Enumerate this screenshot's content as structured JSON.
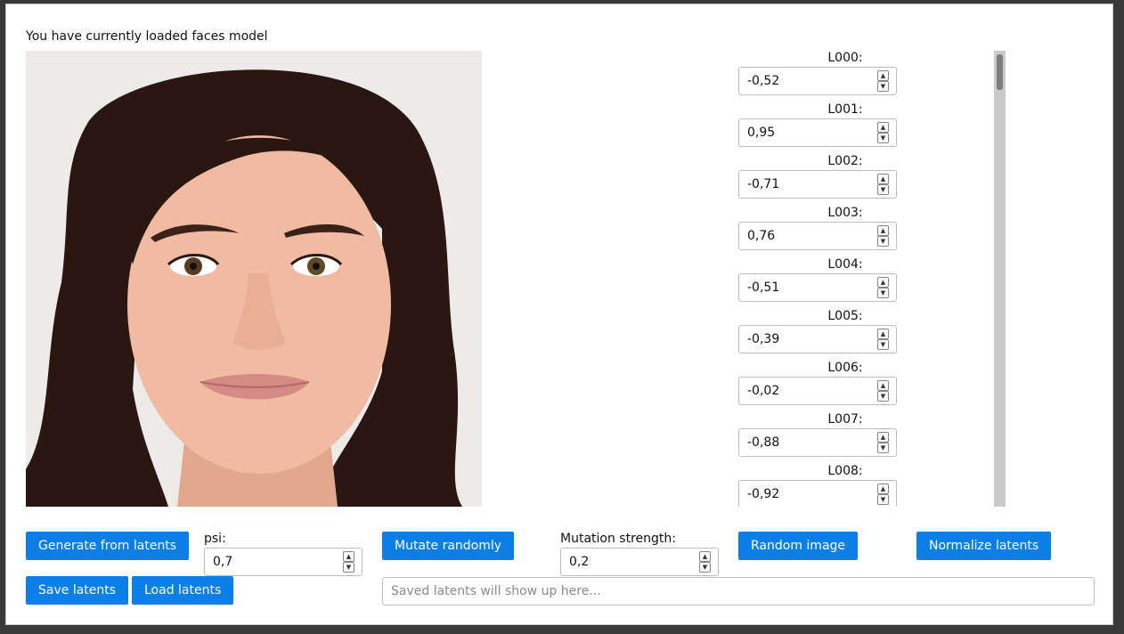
{
  "header": {
    "title": "You have currently loaded faces model"
  },
  "image": {
    "subject": "face-portrait",
    "background_color": "#ecebea"
  },
  "latents": [
    {
      "label": "L000:",
      "value": "-0,52"
    },
    {
      "label": "L001:",
      "value": "0,95"
    },
    {
      "label": "L002:",
      "value": "-0,71"
    },
    {
      "label": "L003:",
      "value": "0,76"
    },
    {
      "label": "L004:",
      "value": "-0,51"
    },
    {
      "label": "L005:",
      "value": "-0,39"
    },
    {
      "label": "L006:",
      "value": "-0,02"
    },
    {
      "label": "L007:",
      "value": "-0,88"
    },
    {
      "label": "L008:",
      "value": "-0,92"
    }
  ],
  "controls": {
    "generate_label": "Generate from latents",
    "psi_label": "psi:",
    "psi_value": "0,7",
    "mutate_label": "Mutate randomly",
    "mutation_strength_label": "Mutation strength:",
    "mutation_strength_value": "0,2",
    "random_image_label": "Random image",
    "normalize_label": "Normalize latents",
    "save_label": "Save latents",
    "load_label": "Load latents",
    "saved_placeholder": "Saved latents will show up here..."
  },
  "colors": {
    "button": "#0b7fe6",
    "page_background": "#3a3a3a",
    "panel": "#ffffff"
  }
}
